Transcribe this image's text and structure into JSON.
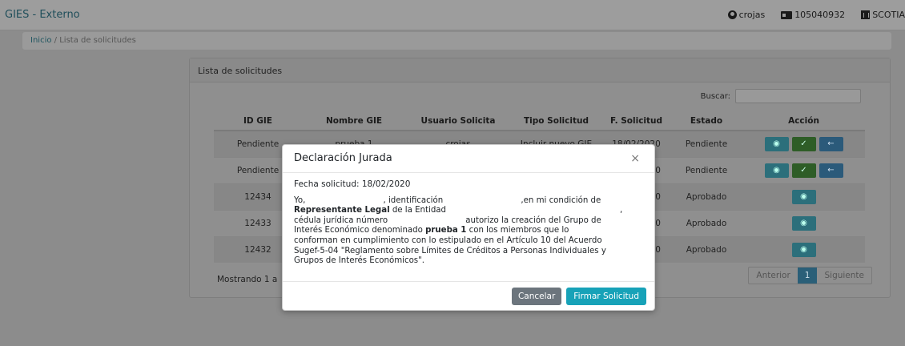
{
  "navbar": {
    "brand": "GIES - Externo",
    "user": "crojas",
    "id": "105040932",
    "bank": "SCOTIA"
  },
  "breadcrumb": {
    "home": "Inicio",
    "separator": "/",
    "current": "Lista de solicitudes"
  },
  "card": {
    "title": "Lista de solicitudes",
    "search_label": "Buscar:",
    "search_value": "",
    "showing_text": "Mostrando 1 a"
  },
  "table": {
    "headers": [
      "ID GIE",
      "Nombre GIE",
      "Usuario Solicita",
      "Tipo Solicitud",
      "F. Solicitud",
      "Estado",
      "Acción"
    ],
    "rows": [
      {
        "id": "Pendiente",
        "nombre": "prueba 1",
        "usuario": "crojas",
        "tipo": "Incluir nuevo GIE",
        "fecha": "18/02/2020",
        "estado": "Pendiente"
      },
      {
        "id": "Pendiente",
        "nombre": "",
        "usuario": "",
        "tipo": "",
        "fecha": "20",
        "estado": "Pendiente"
      },
      {
        "id": "12434",
        "nombre": "",
        "usuario": "",
        "tipo": "",
        "fecha": "20",
        "estado": "Aprobado"
      },
      {
        "id": "12433",
        "nombre": "",
        "usuario": "",
        "tipo": "",
        "fecha": "20",
        "estado": "Aprobado"
      },
      {
        "id": "12432",
        "nombre": "",
        "usuario": "",
        "tipo": "",
        "fecha": "20",
        "estado": "Aprobado"
      }
    ]
  },
  "pagination": {
    "prev": "Anterior",
    "current": "1",
    "next": "Siguiente"
  },
  "modal": {
    "title": "Declaración Jurada",
    "close": "×",
    "date_line": "Fecha solicitud: 18/02/2020",
    "l1a": "Yo,",
    "l1b": ", identificación",
    "l1c": ",en mi condición de",
    "l2_bold": "Representante Legal",
    "l2_rest": " de la Entidad",
    "l2_comma": ",",
    "l3a": "cédula jurídica número",
    "l3b": "autorizo la creación del Grupo de",
    "l4a": "Interés Económico denominado ",
    "l4_bold": "prueba 1",
    "l4b": " con los miembros que lo",
    "l5": "conforman en cumplimiento con lo estipulado en el Artículo 10 del Acuerdo",
    "l6": "Sugef-5-04 \"Reglamento sobre Límites de Créditos a Personas Individuales y",
    "l7": "Grupos de Interés Económicos\".",
    "cancel": "Cancelar",
    "sign": "Firmar Solicitud"
  }
}
